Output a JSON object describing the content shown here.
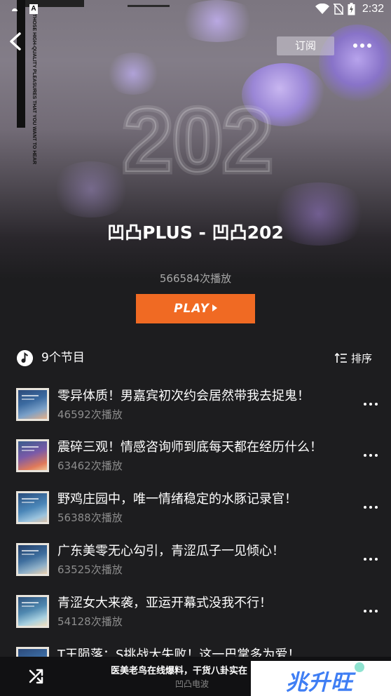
{
  "status_bar": {
    "time": "2:32"
  },
  "header": {
    "subscribe_label": "订阅"
  },
  "hero": {
    "bg_number": "202",
    "poster_text": "THOSE HIGH-QUALITY PLEASURES THAT YOU WANT TO HEAR"
  },
  "album": {
    "title": "凹凸PLUS - 凹凸202",
    "plays": "566584次播放",
    "play_label": "PLAY"
  },
  "list_header": {
    "count": "9个节目",
    "sort_label": "排序"
  },
  "episodes": [
    {
      "title": "零异体质！男嘉宾初次约会居然带我去捉鬼！",
      "plays": "46592次播放"
    },
    {
      "title": "震碎三观！情感咨询师到底每天都在经历什么！",
      "plays": "63462次播放"
    },
    {
      "title": "野鸡庄园中，唯一情绪稳定的水豚记录官！",
      "plays": "56388次播放"
    },
    {
      "title": "广东美零无心勾引，青涩瓜子一见倾心！",
      "plays": "63525次播放"
    },
    {
      "title": "青涩女大来袭，亚运开幕式没我不行！",
      "plays": "54128次播放"
    },
    {
      "title": "T王陨落：S挑战大失败！这一巴掌多为爱！",
      "plays": ""
    }
  ],
  "player": {
    "now_playing": "医美老鸟在线爆料，干货八卦实在",
    "source": "凹凸电波"
  },
  "watermark": {
    "text": "兆升旺"
  },
  "colors": {
    "accent": "#f06a23",
    "background": "#1d1d1f"
  }
}
